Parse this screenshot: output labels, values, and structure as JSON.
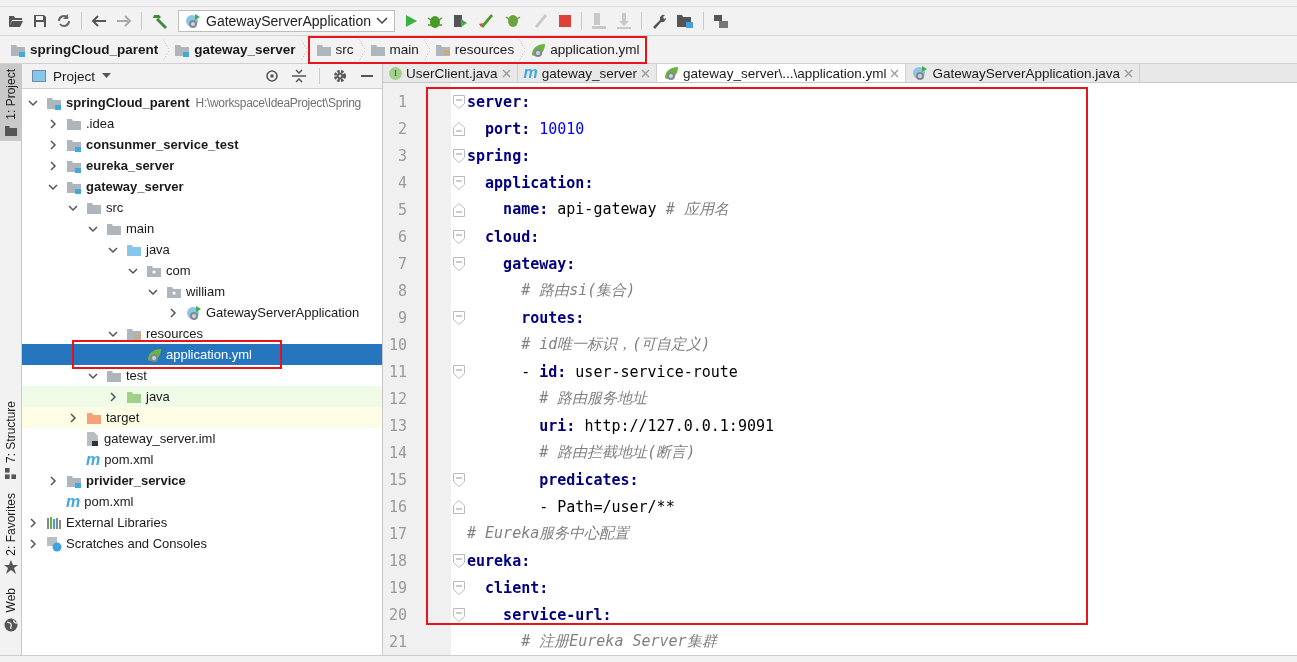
{
  "toolbar": {
    "run_config": "GatewayServerApplication"
  },
  "breadcrumb": [
    {
      "label": "springCloud_parent",
      "kind": "module",
      "bold": true,
      "framed": false
    },
    {
      "label": "gateway_server",
      "kind": "module",
      "bold": true,
      "framed": false
    },
    {
      "label": "src",
      "kind": "folder",
      "bold": false,
      "framed": true
    },
    {
      "label": "main",
      "kind": "folder",
      "bold": false,
      "framed": true
    },
    {
      "label": "resources",
      "kind": "resources",
      "bold": false,
      "framed": true
    },
    {
      "label": "application.yml",
      "kind": "yaml",
      "bold": false,
      "framed": true
    }
  ],
  "side_tabs": [
    {
      "label": "1: Project",
      "kind": "project",
      "selected": true
    },
    {
      "label": "7: Structure",
      "kind": "structure",
      "selected": false
    },
    {
      "label": "2: Favorites",
      "kind": "favorites",
      "selected": false
    },
    {
      "label": "Web",
      "kind": "web",
      "selected": false
    }
  ],
  "project_panel": {
    "title": "Project",
    "tree": [
      {
        "name": "springCloud_parent",
        "kind": "module",
        "bold": true,
        "expanded": true,
        "hint": "H:\\workspace\\IdeaProject\\Spring",
        "children": [
          {
            "name": ".idea",
            "kind": "folder",
            "bold": false,
            "expanded": false
          },
          {
            "name": "consunmer_service_test",
            "kind": "module",
            "bold": true,
            "expanded": false
          },
          {
            "name": "eureka_server",
            "kind": "module",
            "bold": true,
            "expanded": false
          },
          {
            "name": "gateway_server",
            "kind": "module",
            "bold": true,
            "expanded": true,
            "children": [
              {
                "name": "src",
                "kind": "folder",
                "bold": false,
                "expanded": true,
                "children": [
                  {
                    "name": "main",
                    "kind": "folder",
                    "bold": false,
                    "expanded": true,
                    "children": [
                      {
                        "name": "java",
                        "kind": "source-folder",
                        "bold": false,
                        "expanded": true,
                        "children": [
                          {
                            "name": "com",
                            "kind": "package",
                            "bold": false,
                            "expanded": true,
                            "children": [
                              {
                                "name": "william",
                                "kind": "package",
                                "bold": false,
                                "expanded": true,
                                "children": [
                                  {
                                    "name": "GatewayServerApplication",
                                    "kind": "spring-class",
                                    "bold": false,
                                    "expanded": false
                                  }
                                ]
                              }
                            ]
                          }
                        ]
                      },
                      {
                        "name": "resources",
                        "kind": "resources",
                        "bold": false,
                        "expanded": true,
                        "children": [
                          {
                            "name": "application.yml",
                            "kind": "yaml",
                            "bold": false,
                            "selected": true,
                            "framed": true
                          }
                        ]
                      }
                    ]
                  },
                  {
                    "name": "test",
                    "kind": "folder",
                    "bold": false,
                    "expanded": true,
                    "children": [
                      {
                        "name": "java",
                        "kind": "test-folder",
                        "bold": false,
                        "expanded": false
                      }
                    ]
                  }
                ]
              },
              {
                "name": "target",
                "kind": "excluded-folder",
                "bold": false,
                "expanded": false
              },
              {
                "name": "gateway_server.iml",
                "kind": "iml",
                "bold": false
              },
              {
                "name": "pom.xml",
                "kind": "maven",
                "icon_letter": "m",
                "bold": false
              }
            ]
          },
          {
            "name": "privider_service",
            "kind": "module",
            "bold": true,
            "expanded": false
          },
          {
            "name": "pom.xml",
            "kind": "maven",
            "icon_letter": "m",
            "bold": false
          }
        ]
      },
      {
        "name": "External Libraries",
        "kind": "libraries",
        "bold": false,
        "expanded": false
      },
      {
        "name": "Scratches and Consoles",
        "kind": "scratches",
        "bold": false,
        "expanded": false
      }
    ]
  },
  "tabs": [
    {
      "label": "UserClient.java",
      "kind": "interface",
      "icon_letter": "I",
      "selected": false
    },
    {
      "label": "gateway_server",
      "kind": "maven",
      "icon_letter": "m",
      "selected": false
    },
    {
      "label": "gateway_server\\...\\application.yml",
      "kind": "yaml",
      "selected": true
    },
    {
      "label": "GatewayServerApplication.java",
      "kind": "spring-class",
      "selected": false
    }
  ],
  "editor": {
    "lines": [
      {
        "num": "1",
        "fold_start": true,
        "fold_end": false,
        "framed": true,
        "parts": [
          {
            "kind": "key",
            "text": "server:"
          }
        ],
        "children": [
          {
            "num": "2",
            "fold_start": false,
            "fold_end": true,
            "framed": true,
            "parts": [
              {
                "kind": "key",
                "text": "port:"
              },
              {
                "kind": "number",
                "text": "10010"
              }
            ]
          }
        ]
      },
      {
        "num": "3",
        "fold_start": true,
        "fold_end": false,
        "framed": true,
        "parts": [
          {
            "kind": "key",
            "text": "spring:"
          }
        ],
        "children": [
          {
            "num": "4",
            "fold_start": true,
            "fold_end": false,
            "framed": true,
            "parts": [
              {
                "kind": "key",
                "text": "application:"
              }
            ],
            "children": [
              {
                "num": "5",
                "fold_start": false,
                "fold_end": true,
                "framed": true,
                "parts": [
                  {
                    "kind": "key",
                    "text": "name:"
                  },
                  {
                    "kind": "string",
                    "text": "api-gateway"
                  },
                  {
                    "kind": "comment",
                    "text": "# 应用名"
                  }
                ]
              }
            ]
          },
          {
            "num": "6",
            "fold_start": true,
            "fold_end": false,
            "framed": true,
            "parts": [
              {
                "kind": "key",
                "text": "cloud:"
              }
            ],
            "children": [
              {
                "num": "7",
                "fold_start": true,
                "fold_end": false,
                "framed": true,
                "parts": [
                  {
                    "kind": "key",
                    "text": "gateway:"
                  }
                ],
                "children": [
                  {
                    "num": "8",
                    "fold_start": false,
                    "fold_end": false,
                    "framed": true,
                    "parts": [
                      {
                        "kind": "comment",
                        "text": "# 路由si(集合)"
                      }
                    ]
                  },
                  {
                    "num": "9",
                    "fold_start": true,
                    "fold_end": false,
                    "framed": true,
                    "parts": [
                      {
                        "kind": "key",
                        "text": "routes:"
                      }
                    ]
                  },
                  {
                    "num": "10",
                    "fold_start": false,
                    "fold_end": false,
                    "framed": true,
                    "parts": [
                      {
                        "kind": "comment",
                        "text": "# id唯一标识，(可自定义)"
                      }
                    ]
                  },
                  {
                    "num": "11",
                    "fold_start": true,
                    "fold_end": false,
                    "framed": true,
                    "parts": [
                      {
                        "kind": "dash",
                        "text": "-"
                      },
                      {
                        "kind": "key",
                        "text": "id:"
                      },
                      {
                        "kind": "string",
                        "text": "user-service-route"
                      }
                    ],
                    "children": [
                      {
                        "num": "12",
                        "fold_start": false,
                        "fold_end": false,
                        "framed": true,
                        "parts": [
                          {
                            "kind": "comment",
                            "text": "# 路由服务地址"
                          }
                        ]
                      },
                      {
                        "num": "13",
                        "fold_start": false,
                        "fold_end": false,
                        "framed": true,
                        "parts": [
                          {
                            "kind": "key",
                            "text": "uri:"
                          },
                          {
                            "kind": "string",
                            "text": "http://127.0.0.1:9091"
                          }
                        ]
                      },
                      {
                        "num": "14",
                        "fold_start": false,
                        "fold_end": false,
                        "framed": true,
                        "parts": [
                          {
                            "kind": "comment",
                            "text": "# 路由拦截地址(断言)"
                          }
                        ]
                      },
                      {
                        "num": "15",
                        "fold_start": true,
                        "fold_end": false,
                        "framed": true,
                        "parts": [
                          {
                            "kind": "key",
                            "text": "predicates:"
                          }
                        ]
                      },
                      {
                        "num": "16",
                        "fold_start": false,
                        "fold_end": true,
                        "framed": true,
                        "parts": [
                          {
                            "kind": "dash",
                            "text": "-"
                          },
                          {
                            "kind": "string",
                            "text": "Path=/user/**"
                          }
                        ]
                      }
                    ]
                  }
                ]
              }
            ]
          }
        ]
      },
      {
        "num": "17",
        "fold_start": false,
        "fold_end": false,
        "framed": true,
        "parts": [
          {
            "kind": "comment",
            "text": "# Eureka服务中心配置"
          }
        ]
      },
      {
        "num": "18",
        "fold_start": true,
        "fold_end": false,
        "framed": true,
        "parts": [
          {
            "kind": "key",
            "text": "eureka:"
          }
        ],
        "children": [
          {
            "num": "19",
            "fold_start": true,
            "fold_end": false,
            "framed": true,
            "parts": [
              {
                "kind": "key",
                "text": "client:"
              }
            ],
            "children": [
              {
                "num": "20",
                "fold_start": true,
                "fold_end": false,
                "framed": true,
                "parts": [
                  {
                    "kind": "key",
                    "text": "service-url:"
                  }
                ],
                "children": [
                  {
                    "num": "21",
                    "fold_start": false,
                    "fold_end": false,
                    "framed": false,
                    "parts": [
                      {
                        "kind": "comment",
                        "text": "# 注册Eureka Server集群"
                      }
                    ]
                  }
                ]
              }
            ]
          }
        ]
      }
    ]
  }
}
